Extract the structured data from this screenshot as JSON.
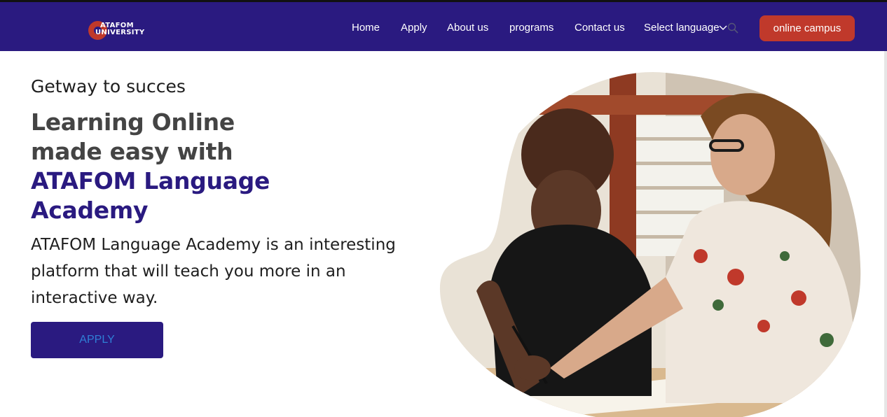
{
  "brand": {
    "logo_line1": "ATAFOM",
    "logo_line2": "UNIVERSITY"
  },
  "nav": {
    "items": [
      {
        "label": "Home"
      },
      {
        "label": "Apply"
      },
      {
        "label": "About us"
      },
      {
        "label": "programs"
      },
      {
        "label": "Contact us"
      },
      {
        "label": "Select language"
      }
    ],
    "campus_button": "online campus"
  },
  "hero": {
    "tagline": "Getway to succes",
    "headline_line1": "Learning Online",
    "headline_line2": "made easy with",
    "headline_line3": "ATAFOM Language",
    "headline_line4": "Academy",
    "description": "ATAFOM Language Academy is an interesting platform that will teach you more in an interactive way.",
    "apply_button": "APPLY"
  },
  "icons": [
    "chevron-down-icon",
    "search-icon"
  ],
  "colors": {
    "nav_bg": "#2a1a80",
    "accent": "#c0392b",
    "heading_purple": "#2a1a80",
    "heading_gray": "#444444",
    "apply_text": "#2f7fd6"
  }
}
